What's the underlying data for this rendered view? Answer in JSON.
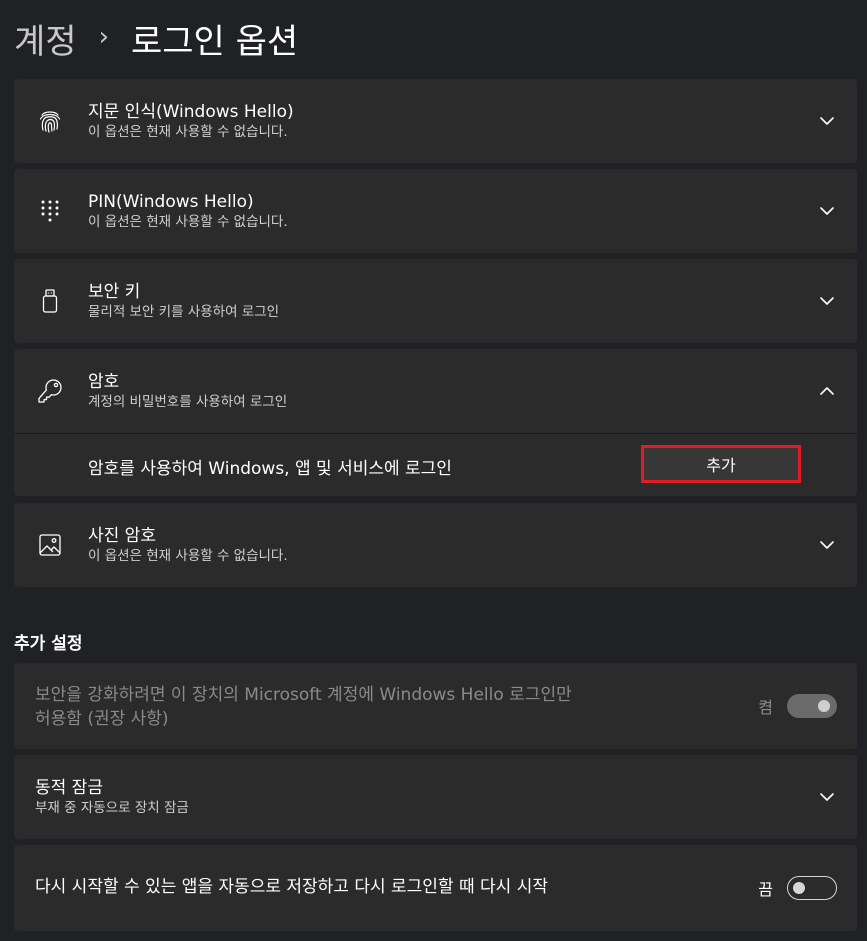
{
  "breadcrumb": {
    "parent": "계정",
    "separator": "›",
    "current": "로그인 옵션"
  },
  "options": {
    "fingerprint": {
      "title": "지문 인식(Windows Hello)",
      "subtitle": "이 옵션은 현재 사용할 수 없습니다.",
      "icon": "fingerprint-icon"
    },
    "pin": {
      "title": "PIN(Windows Hello)",
      "subtitle": "이 옵션은 현재 사용할 수 없습니다.",
      "icon": "keypad-icon"
    },
    "security_key": {
      "title": "보안 키",
      "subtitle": "물리적 보안 키를 사용하여 로그인",
      "icon": "usb-key-icon"
    },
    "password": {
      "title": "암호",
      "subtitle": "계정의 비밀번호를 사용하여 로그인",
      "icon": "key-icon",
      "expanded": true,
      "detail_text": "암호를 사용하여 Windows, 앱 및 서비스에 로그인",
      "add_button_label": "추가"
    },
    "picture_password": {
      "title": "사진 암호",
      "subtitle": "이 옵션은 현재 사용할 수 없습니다.",
      "icon": "picture-icon"
    }
  },
  "additional": {
    "header": "추가 설정",
    "windows_hello_only": {
      "line1": "보안을 강화하려면 이 장치의 Microsoft 계정에 Windows Hello 로그인만",
      "line2": "허용함 (권장 사항)",
      "toggle_label": "켬",
      "state": "on",
      "disabled": true
    },
    "dynamic_lock": {
      "title": "동적 잠금",
      "subtitle": "부재 중 자동으로 장치 잠금"
    },
    "restart_apps": {
      "title": "다시 시작할 수 있는 앱을 자동으로 저장하고 다시 로그인할 때 다시 시작",
      "toggle_label": "끔",
      "state": "off"
    }
  },
  "colors": {
    "background": "#202124",
    "card": "#2b2b2b",
    "highlight_border": "#e01b24"
  }
}
